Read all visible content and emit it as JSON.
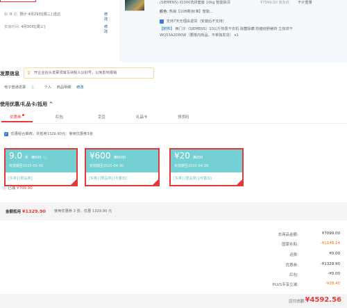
{
  "shipping": {
    "standard": {
      "label": "标 准 达:",
      "value": "预计 4月29日[周二] 送达",
      "edit": "修改"
    },
    "install": {
      "label": "安装时间:",
      "value": "4月30日[周三]",
      "edit": "修改"
    }
  },
  "product": {
    "title": "(SIEMENS) IQ300洗烘套装 10kg 智能除渍",
    "price": "¥7099.00 京东价",
    "status": "不计重量",
    "attr_label": "颜色:",
    "attr_value": "热销【108寄|标准】智能...",
    "return_policy": "支持7天无理由退货（安装后不支持）",
    "gift_tag": "【附件】",
    "gift_text": "西门子（SIEMENS）10公斤热泵干衣机 除菌除螨 防缠绕舒缓烘 立体烘干 WQ53A2D80W（要搭内商品，不单独发货） x1"
  },
  "invoice": {
    "title": "发票信息",
    "tip": "开企业抬头发票须填写纳税人识别号，以免影响报销",
    "type": "电子普通发票",
    "person": "个人",
    "detail": "商品明细",
    "edit": "修改"
  },
  "coupons": {
    "title": "使用优惠/礼品卡/抵用",
    "toggle": "^",
    "tabs": [
      "优惠券",
      "红包",
      "京豆",
      "礼品卡",
      "领货码"
    ],
    "combo_text": "优惠组合推荐，共抵用1329.90元：使用优惠券3张",
    "cards": [
      {
        "amount": "9.0",
        "unit": "折",
        "cond": "满500",
        "valid": "有效期至2025-05-05",
        "foot": "[东券] [限品类]"
      },
      {
        "amount": "¥600",
        "unit": "",
        "cond": "满6000",
        "valid": "有效期至2025-04-30",
        "foot": "[东券] [限品类] [可叠加]"
      },
      {
        "amount": "¥20",
        "unit": "",
        "cond": "满200",
        "valid": "有效期至2025-04-28",
        "foot": "[东券] [限品类] [可叠加]"
      }
    ],
    "reduced_label": "已减",
    "reduced_value": "¥709.90"
  },
  "summary": {
    "label": "金额抵用",
    "value": "¥1329.90",
    "detail": "使用优惠券 3 张，优惠 1329.90 元"
  },
  "totals": [
    {
      "label": "总商品金额:",
      "value": "¥7099.00",
      "highlight": false
    },
    {
      "label": "国家补贴:",
      "value": "-¥1148.14",
      "highlight": true
    },
    {
      "label": "运费:",
      "value": "¥0.00",
      "highlight": false
    },
    {
      "label": "优惠券:",
      "value": "-¥1329.90",
      "highlight": false
    },
    {
      "label": "红包:",
      "value": "-¥0.00",
      "highlight": false
    },
    {
      "label": "PLUS专享立减:",
      "value": "-¥28.40",
      "highlight": true
    }
  ],
  "payable": {
    "label": "应付总额:",
    "value": "¥4592.56"
  },
  "colors": {
    "accent": "#e4393c",
    "coupon": "#74d0d2",
    "link": "#005aa0",
    "orange": "#ff6a00"
  }
}
